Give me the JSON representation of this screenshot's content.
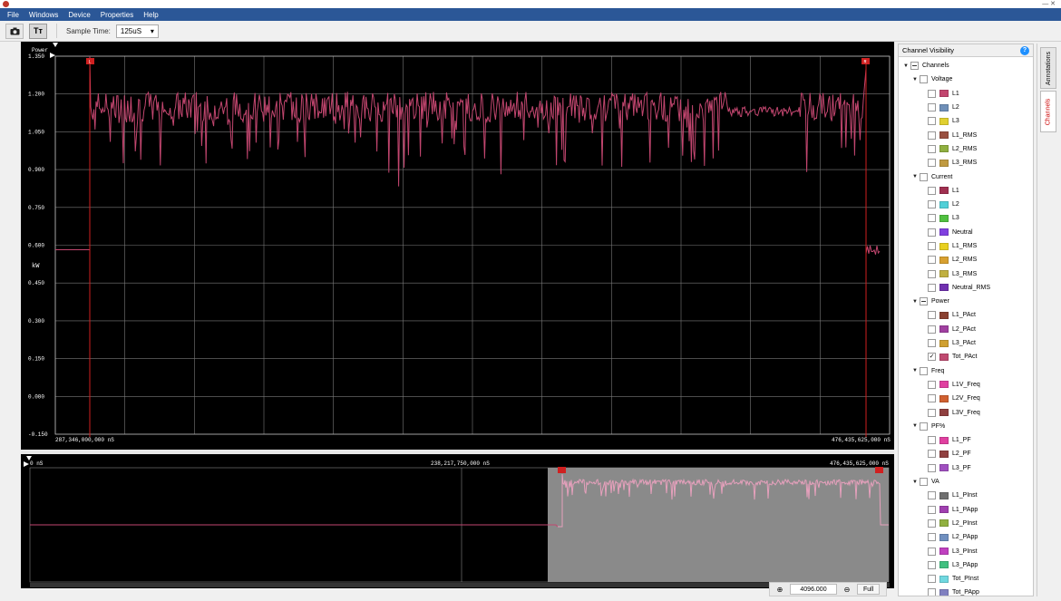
{
  "menu": [
    "File",
    "Windows",
    "Device",
    "Properties",
    "Help"
  ],
  "toolbar": {
    "camera_icon": "camera-icon",
    "text_button_label": "Tт",
    "sample_time_label": "Sample Time:",
    "sample_time_value": "125uS"
  },
  "main_plot": {
    "channel_title": "Power",
    "unit": "kW",
    "y_ticks": [
      "1.350",
      "1.200",
      "1.050",
      "0.900",
      "0.750",
      "0.600",
      "0.450",
      "0.300",
      "0.150",
      "0.000",
      "-0.150"
    ],
    "x_start_label": "287,346,000,000 nS",
    "x_end_label": "476,435,625,000 nS",
    "marker_left": "L",
    "marker_right": "R"
  },
  "overview": {
    "left_label": "0 nS",
    "mid_label": "238,217,750,000 nS",
    "right_label": "476,435,625,000 nS"
  },
  "zoom": {
    "value": "4096.000",
    "full_label": "Full"
  },
  "panel": {
    "title": "Channel Visibility",
    "help": "?",
    "tab_annotations": "Annotations",
    "tab_channels": "Channels",
    "tree": [
      {
        "level": 0,
        "label": "Channels",
        "state": "partial",
        "arrow": true
      },
      {
        "level": 1,
        "label": "Voltage",
        "state": "off",
        "arrow": true
      },
      {
        "level": 2,
        "label": "L1",
        "color": "#c2466f"
      },
      {
        "level": 2,
        "label": "L2",
        "color": "#6f8fb8"
      },
      {
        "level": 2,
        "label": "L3",
        "color": "#e0d030"
      },
      {
        "level": 2,
        "label": "L1_RMS",
        "color": "#9a5040"
      },
      {
        "level": 2,
        "label": "L2_RMS",
        "color": "#90b040"
      },
      {
        "level": 2,
        "label": "L3_RMS",
        "color": "#c09a40"
      },
      {
        "level": 1,
        "label": "Current",
        "state": "off",
        "arrow": true
      },
      {
        "level": 2,
        "label": "L1",
        "color": "#a03050"
      },
      {
        "level": 2,
        "label": "L2",
        "color": "#50d0d8"
      },
      {
        "level": 2,
        "label": "L3",
        "color": "#50c040"
      },
      {
        "level": 2,
        "label": "Neutral",
        "color": "#8040e0"
      },
      {
        "level": 2,
        "label": "L1_RMS",
        "color": "#e8d020"
      },
      {
        "level": 2,
        "label": "L2_RMS",
        "color": "#d8a030"
      },
      {
        "level": 2,
        "label": "L3_RMS",
        "color": "#c0b040"
      },
      {
        "level": 2,
        "label": "Neutral_RMS",
        "color": "#7030b0"
      },
      {
        "level": 1,
        "label": "Power",
        "state": "partial",
        "arrow": true
      },
      {
        "level": 2,
        "label": "L1_PAct",
        "color": "#8a4030"
      },
      {
        "level": 2,
        "label": "L2_PAct",
        "color": "#a040a0"
      },
      {
        "level": 2,
        "label": "L3_PAct",
        "color": "#d0a030"
      },
      {
        "level": 2,
        "label": "Tot_PAct",
        "color": "#c04a70",
        "checked": true
      },
      {
        "level": 1,
        "label": "Freq",
        "state": "off",
        "arrow": true
      },
      {
        "level": 2,
        "label": "L1V_Freq",
        "color": "#e040a0"
      },
      {
        "level": 2,
        "label": "L2V_Freq",
        "color": "#d06030"
      },
      {
        "level": 2,
        "label": "L3V_Freq",
        "color": "#904040"
      },
      {
        "level": 1,
        "label": "PF%",
        "state": "off",
        "arrow": true
      },
      {
        "level": 2,
        "label": "L1_PF",
        "color": "#e040a0"
      },
      {
        "level": 2,
        "label": "L2_PF",
        "color": "#904040"
      },
      {
        "level": 2,
        "label": "L3_PF",
        "color": "#a050c0"
      },
      {
        "level": 1,
        "label": "VA",
        "state": "off",
        "arrow": true
      },
      {
        "level": 2,
        "label": "L1_PInst",
        "color": "#707070"
      },
      {
        "level": 2,
        "label": "L1_PApp",
        "color": "#a040b0"
      },
      {
        "level": 2,
        "label": "L2_PInst",
        "color": "#90b040"
      },
      {
        "level": 2,
        "label": "L2_PApp",
        "color": "#7090c0"
      },
      {
        "level": 2,
        "label": "L3_PInst",
        "color": "#c040c0"
      },
      {
        "level": 2,
        "label": "L3_PApp",
        "color": "#40c080"
      },
      {
        "level": 2,
        "label": "Tot_PInst",
        "color": "#70d8e0"
      },
      {
        "level": 2,
        "label": "Tot_PApp",
        "color": "#8080c0"
      }
    ]
  },
  "colors": {
    "trace": "#c2466f",
    "overview_trace": "#e6a0bc",
    "grid": "#7a7a7a",
    "marker": "#d02020"
  }
}
